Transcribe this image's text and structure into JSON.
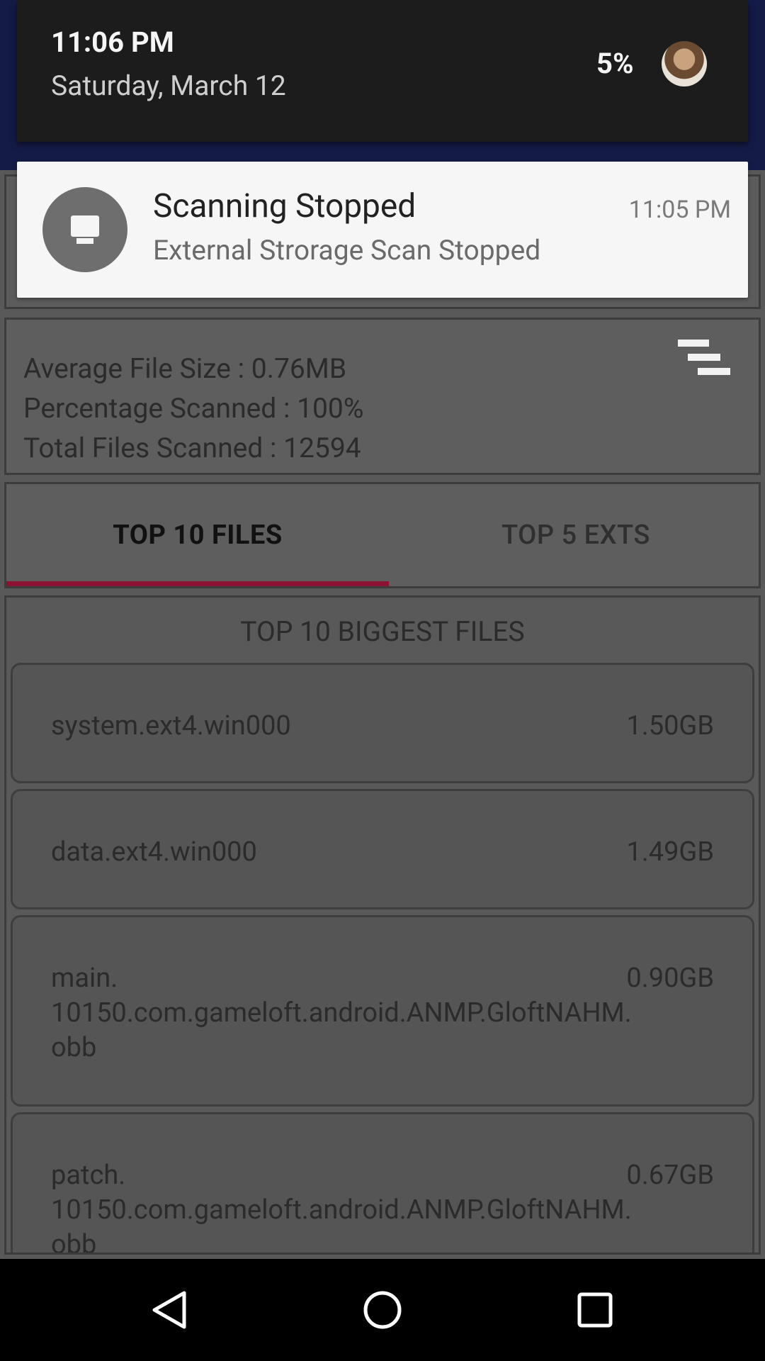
{
  "status": {
    "time": "11:06 PM",
    "date": "Saturday, March 12",
    "battery": "5%"
  },
  "notification": {
    "title": "Scanning Stopped",
    "text": "External Strorage Scan Stopped",
    "time": "11:05 PM",
    "icon": "monitor-icon"
  },
  "stats": {
    "average": "Average File Size : 0.76MB",
    "percentage": "Percentage Scanned : 100%",
    "total": "Total Files Scanned : 12594"
  },
  "tabs": [
    {
      "label": "TOP 10 FILES",
      "active": true
    },
    {
      "label": "TOP 5 EXTS",
      "active": false
    }
  ],
  "list": {
    "title": "TOP 10 BIGGEST FILES",
    "items": [
      {
        "name": "system.ext4.win000",
        "size": "1.50GB"
      },
      {
        "name": "data.ext4.win000",
        "size": "1.49GB"
      },
      {
        "name": "main.\n10150.com.gameloft.android.ANMP.GloftNAHM.obb",
        "size": "0.90GB"
      },
      {
        "name": "patch.\n10150.com.gameloft.android.ANMP.GloftNAHM.obb",
        "size": "0.67GB"
      }
    ]
  },
  "colors": {
    "accent": "#8c1334",
    "appbar": "#1f2a6e"
  }
}
